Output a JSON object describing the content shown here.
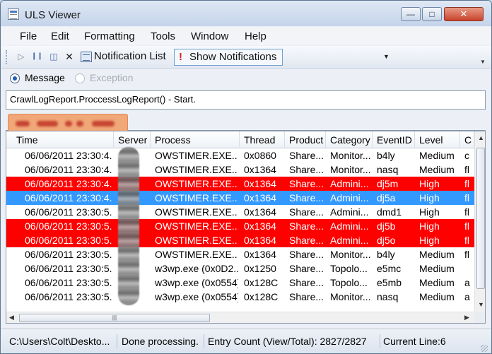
{
  "window": {
    "title": "ULS Viewer"
  },
  "menu": [
    "File",
    "Edit",
    "Formatting",
    "Tools",
    "Window",
    "Help"
  ],
  "toolbar": {
    "play_icon": "play-icon",
    "pause_icon": "pause-icon",
    "clear_icon": "clear-filter-icon",
    "close_icon": "close-icon",
    "notification_list_label": "Notification List",
    "show_notifications_label": "Show Notifications"
  },
  "radios": [
    {
      "label": "Message",
      "checked": true,
      "enabled": true
    },
    {
      "label": "Exception",
      "checked": false,
      "enabled": false
    }
  ],
  "message_text": "CrawlLogReport.ProccessLogReport() - Start.",
  "columns": [
    "Time",
    "Server",
    "Process",
    "Thread",
    "Product",
    "Category",
    "EventID",
    "Level",
    "C"
  ],
  "rows": [
    {
      "time": "06/06/2011 23:30:4...",
      "server": "",
      "process": "OWSTIMER.EXE...",
      "thread": "0x0860",
      "product": "Share...",
      "category": "Monitor...",
      "event": "b4ly",
      "level": "Medium",
      "extra": "c",
      "style": "normal"
    },
    {
      "time": "06/06/2011 23:30:4...",
      "server": "",
      "process": "OWSTIMER.EXE...",
      "thread": "0x1364",
      "product": "Share...",
      "category": "Monitor...",
      "event": "nasq",
      "level": "Medium",
      "extra": "fl",
      "style": "normal"
    },
    {
      "time": "06/06/2011 23:30:4...",
      "server": "",
      "process": "OWSTIMER.EXE...",
      "thread": "0x1364",
      "product": "Share...",
      "category": "Admini...",
      "event": "dj5m",
      "level": "High",
      "extra": "fl",
      "style": "red"
    },
    {
      "time": "06/06/2011 23:30:4...",
      "server": "",
      "process": "OWSTIMER.EXE...",
      "thread": "0x1364",
      "product": "Share...",
      "category": "Admini...",
      "event": "dj5a",
      "level": "High",
      "extra": "fl",
      "style": "selected"
    },
    {
      "time": "06/06/2011 23:30:5...",
      "server": "",
      "process": "OWSTIMER.EXE...",
      "thread": "0x1364",
      "product": "Share...",
      "category": "Admini...",
      "event": "dmd1",
      "level": "High",
      "extra": "fl",
      "style": "normal"
    },
    {
      "time": "06/06/2011 23:30:5...",
      "server": "",
      "process": "OWSTIMER.EXE...",
      "thread": "0x1364",
      "product": "Share...",
      "category": "Admini...",
      "event": "dj5b",
      "level": "High",
      "extra": "fl",
      "style": "red"
    },
    {
      "time": "06/06/2011 23:30:5...",
      "server": "",
      "process": "OWSTIMER.EXE...",
      "thread": "0x1364",
      "product": "Share...",
      "category": "Admini...",
      "event": "dj5o",
      "level": "High",
      "extra": "fl",
      "style": "red"
    },
    {
      "time": "06/06/2011 23:30:5...",
      "server": "",
      "process": "OWSTIMER.EXE...",
      "thread": "0x1364",
      "product": "Share...",
      "category": "Monitor...",
      "event": "b4ly",
      "level": "Medium",
      "extra": "fl",
      "style": "normal"
    },
    {
      "time": "06/06/2011 23:30:5...",
      "server": "",
      "process": "w3wp.exe (0x0D2...",
      "thread": "0x1250",
      "product": "Share...",
      "category": "Topolo...",
      "event": "e5mc",
      "level": "Medium",
      "extra": "",
      "style": "normal"
    },
    {
      "time": "06/06/2011 23:30:5...",
      "server": "",
      "process": "w3wp.exe (0x0554)",
      "thread": "0x128C",
      "product": "Share...",
      "category": "Topolo...",
      "event": "e5mb",
      "level": "Medium",
      "extra": "a",
      "style": "normal"
    },
    {
      "time": "06/06/2011 23:30:5...",
      "server": "",
      "process": "w3wp.exe (0x0554)",
      "thread": "0x128C",
      "product": "Share...",
      "category": "Monitor...",
      "event": "nasq",
      "level": "Medium",
      "extra": "a",
      "style": "normal"
    }
  ],
  "status": {
    "path": "C:\\Users\\Colt\\Deskto...",
    "state": "Done processing.",
    "entry_count": "Entry Count (View/Total): 2827/2827",
    "current_line": "Current Line:6"
  },
  "colors": {
    "red_row": "#ff0000",
    "selected_row": "#3399ff",
    "server_tab": "#f1a878"
  }
}
